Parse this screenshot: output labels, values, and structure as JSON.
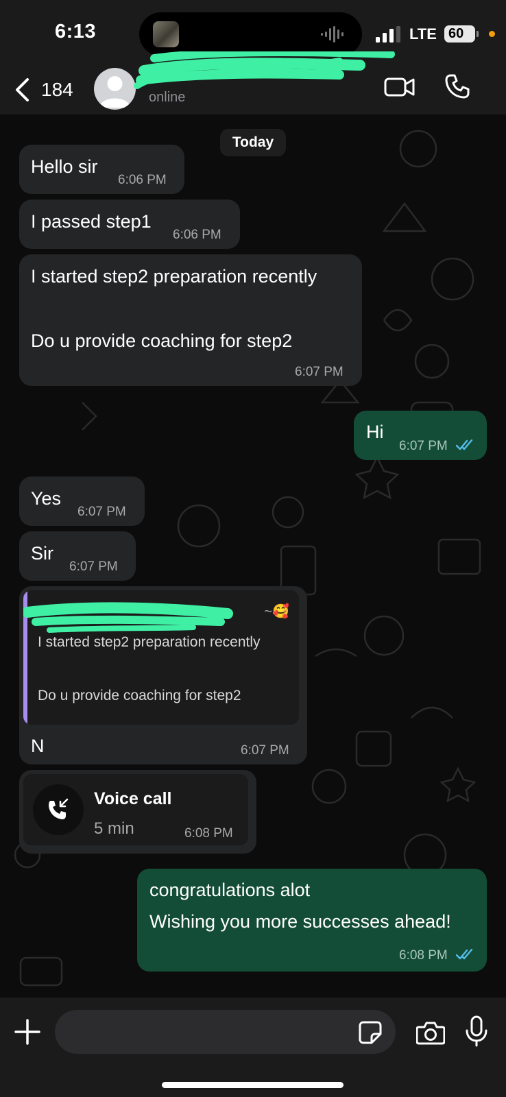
{
  "status_bar": {
    "time": "6:13",
    "network": "LTE",
    "battery": "60",
    "icons": [
      "signal-icon",
      "battery-icon",
      "audio-wave-icon"
    ]
  },
  "header": {
    "back_count": "184",
    "contact_name": "",
    "presence": "online",
    "icons": [
      "chevron-left-icon",
      "avatar-icon",
      "video-camera-icon",
      "phone-icon"
    ]
  },
  "chat": {
    "date_separator": "Today",
    "messages": [
      {
        "direction": "incoming",
        "text": "Hello sir",
        "time": "6:06 PM"
      },
      {
        "direction": "incoming",
        "text": "I passed step1",
        "time": "6:06 PM"
      },
      {
        "direction": "incoming",
        "lines": [
          "I started step2 preparation recently",
          "Do u provide coaching for step2"
        ],
        "time": "6:07 PM"
      },
      {
        "direction": "outgoing",
        "text": "Hi",
        "time": "6:07 PM",
        "status": "read"
      },
      {
        "direction": "incoming",
        "text": "Yes",
        "time": "6:07 PM"
      },
      {
        "direction": "incoming",
        "text": "Sir",
        "time": "6:07 PM"
      },
      {
        "direction": "incoming",
        "reply_to": {
          "author": "",
          "tag": "~🥰",
          "lines": [
            "I started step2 preparation recently",
            "Do u provide coaching for step2"
          ]
        },
        "text": "N",
        "time": "6:07 PM"
      },
      {
        "direction": "incoming",
        "type": "call",
        "call_title": "Voice call",
        "call_duration": "5 min",
        "time": "6:08 PM"
      },
      {
        "direction": "outgoing",
        "lines": [
          "congratulations alot",
          "Wishing you more successes ahead!"
        ],
        "time": "6:08 PM",
        "status": "read"
      }
    ]
  },
  "input_bar": {
    "placeholder": "",
    "icons": [
      "plus-icon",
      "sticker-icon",
      "camera-icon",
      "microphone-icon"
    ]
  },
  "colors": {
    "incoming_bubble": "#242526",
    "outgoing_bubble": "#144d37",
    "read_ticks": "#53bdeb",
    "redaction_marker": "#3ff0a4",
    "reply_bar": "#a88cf0"
  }
}
